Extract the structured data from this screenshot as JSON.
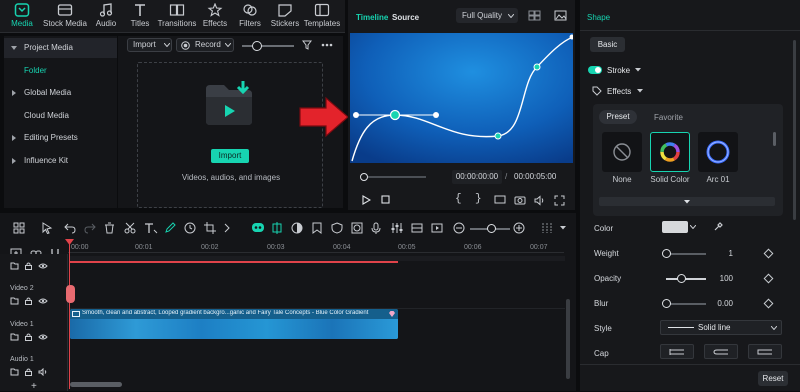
{
  "nav": {
    "items": [
      {
        "label": "Media",
        "icon": "media-icon",
        "active": true
      },
      {
        "label": "Stock Media",
        "icon": "stock-media-icon"
      },
      {
        "label": "Audio",
        "icon": "music-note-icon"
      },
      {
        "label": "Titles",
        "icon": "titles-icon"
      },
      {
        "label": "Transitions",
        "icon": "transitions-icon"
      },
      {
        "label": "Effects",
        "icon": "effects-icon"
      },
      {
        "label": "Filters",
        "icon": "filters-icon"
      },
      {
        "label": "Stickers",
        "icon": "stickers-icon"
      },
      {
        "label": "Templates",
        "icon": "templates-icon"
      }
    ]
  },
  "sidebar": {
    "items": [
      {
        "label": "Project Media"
      },
      {
        "label": "Folder"
      },
      {
        "label": "Global Media"
      },
      {
        "label": "Cloud Media"
      },
      {
        "label": "Editing Presets"
      },
      {
        "label": "Influence Kit"
      }
    ]
  },
  "media": {
    "import_label": "Import",
    "record_label": "Record",
    "import_button": "Import",
    "hint": "Videos, audios, and images"
  },
  "preview": {
    "tab_timeline": "Timeline",
    "tab_source": "Source",
    "quality": "Full Quality",
    "current_time": "00:00:00:00",
    "total_time": "00:00:05:00"
  },
  "right": {
    "section_title": "Shape",
    "tab_basic": "Basic",
    "stroke_label": "Stroke",
    "effects_label": "Effects",
    "preset_tab": "Preset",
    "favorite_tab": "Favorite",
    "presets": [
      {
        "label": "None"
      },
      {
        "label": "Solid Color"
      },
      {
        "label": "Arc 01"
      }
    ],
    "color_label": "Color",
    "weight_label": "Weight",
    "weight_value": "1",
    "opacity_label": "Opacity",
    "opacity_value": "100",
    "blur_label": "Blur",
    "blur_value": "0.00",
    "style_label": "Style",
    "style_value": "Solid line",
    "cap_label": "Cap",
    "reset_label": "Reset"
  },
  "timeline": {
    "ticks": [
      "00:00",
      "00:01",
      "00:02",
      "00:03",
      "00:04",
      "00:05",
      "00:06",
      "00:07"
    ],
    "tracks": [
      "Video 2",
      "Video 1",
      "Audio 1"
    ],
    "clip_title": "Smooth, clean and abstract, Looped gradient backgro...ganic and Fairy Tale Concepts - Blue Color Gradient"
  },
  "colors": {
    "accent": "#17d4b1",
    "playhead": "#e0434a",
    "clip": "#1f8fc9",
    "arrow": "#e3232b"
  }
}
